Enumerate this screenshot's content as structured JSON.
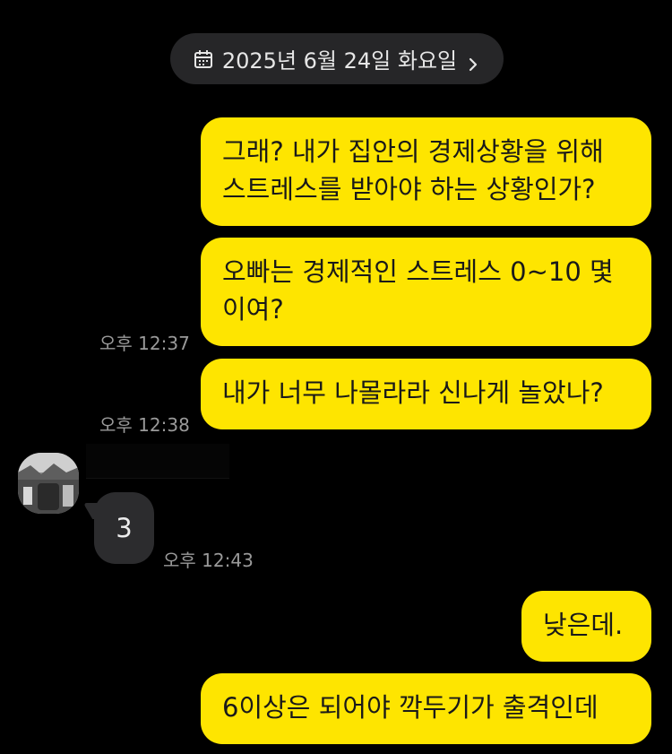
{
  "header": {
    "date_label": "2025년 6월 24일 화요일",
    "calendar_icon": "calendar-icon",
    "chevron_icon": "chevron-right-icon"
  },
  "colors": {
    "background": "#000000",
    "my_bubble": "#fee500",
    "their_bubble": "#2c2c2e",
    "timestamp": "#9a9a9a",
    "date_pill": "#262628"
  },
  "messages": [
    {
      "lines": [
        "그래? 내가 집안의 경제상황을 위해",
        "스트레스를 받아야 하는 상황인가?"
      ]
    },
    {
      "lines": [
        "오빠는 경제적인 스트레스 0~10 몇",
        "이여?"
      ],
      "time": "오후 12:37"
    },
    {
      "lines": [
        "내가 너무 나몰라라 신나게 놀았나?"
      ],
      "time": "오후 12:38"
    },
    {
      "text": "3",
      "time": "오후 12:43"
    },
    {
      "lines": [
        "낮은데."
      ]
    },
    {
      "lines": [
        "6이상은 되어야 깍두기가 출격인데"
      ]
    }
  ]
}
